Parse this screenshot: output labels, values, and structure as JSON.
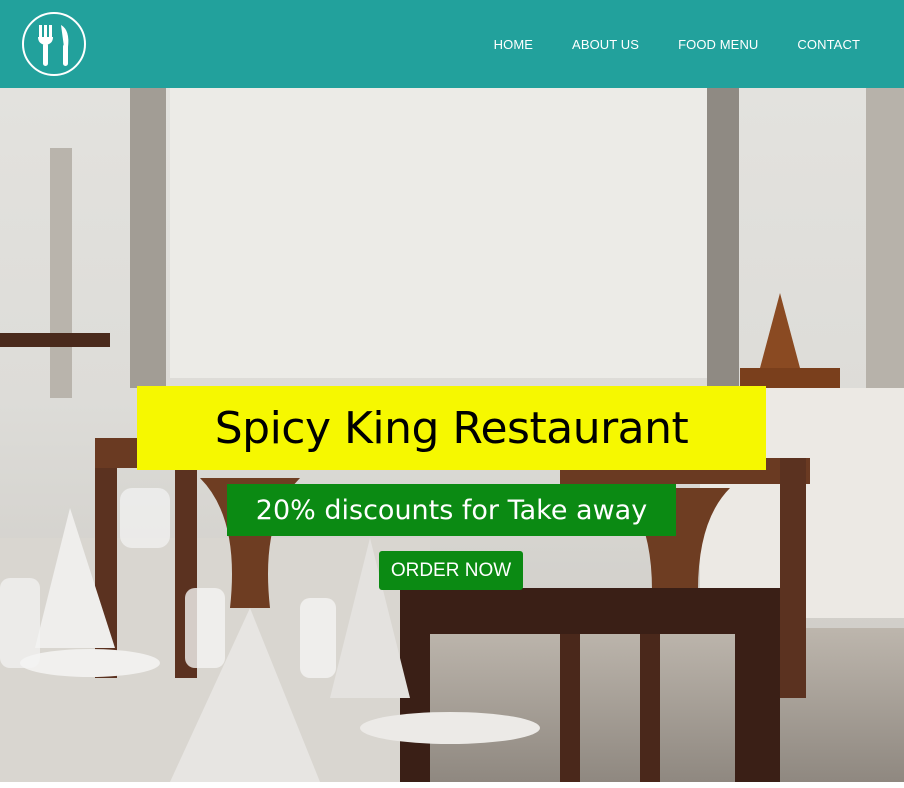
{
  "header": {
    "logo_icon": "fork-knife-icon",
    "nav": [
      {
        "label": "HOME"
      },
      {
        "label": "ABOUT US"
      },
      {
        "label": "FOOD MENU"
      },
      {
        "label": "CONTACT"
      }
    ]
  },
  "hero": {
    "background": "restaurant-dining-room-photo",
    "title": "Spicy King Restaurant",
    "subtitle": "20% discounts for Take away",
    "cta_label": "ORDER NOW"
  },
  "colors": {
    "navbar": "#22a19c",
    "title_bg": "#f6f800",
    "accent_green": "#0b8a13"
  }
}
